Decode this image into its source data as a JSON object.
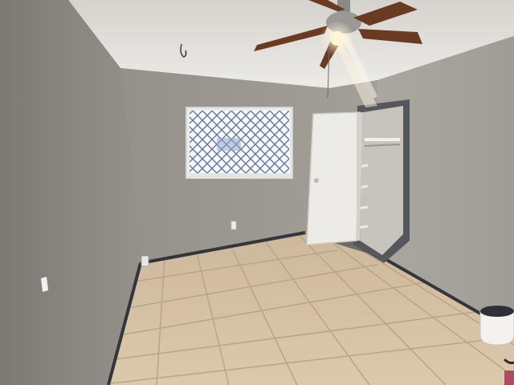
{
  "scene": {
    "description_free": true,
    "palette": {
      "ceiling": "#e3e1dc",
      "left_wall": "#8c8882",
      "back_wall": "#9d9993",
      "right_wall": "#a8a49e",
      "floor_tile": "#d9c4a6",
      "grout": "#b9a78c",
      "baseboard": "#3a3c44",
      "door": "#ecebe7",
      "closet_interior": "#c9c5bf",
      "window_light": "#f4f6f8",
      "window_grille": "#4c5d8c",
      "fan_blade": "#6b3a22",
      "fan_light": "#fff3c8"
    }
  }
}
